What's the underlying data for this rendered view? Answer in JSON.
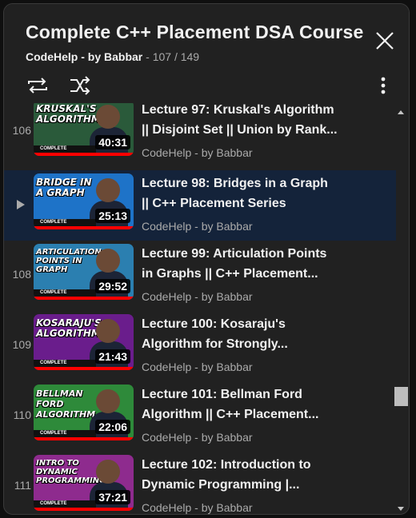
{
  "playlist": {
    "title": "Complete C++ Placement DSA Course",
    "channel": "CodeHelp - by Babbar",
    "position": "- 107 / 149"
  },
  "icons": {
    "close": "close-icon",
    "loop": "loop-icon",
    "shuffle": "shuffle-icon",
    "more": "more-vert-icon"
  },
  "colors": {
    "panel": "#212121",
    "active_row": "#14233a",
    "progress": "#ff0000"
  },
  "videos": [
    {
      "index": "106",
      "title_line1": "Lecture 97: Kruskal's Algorithm",
      "title_line2": "|| Disjoint Set || Union by Rank...",
      "channel": "CodeHelp - by Babbar",
      "thumb_text": "KRUSKAL'S ALGORITHM",
      "thumb_badge": "COMPLETE",
      "duration": "40:31",
      "thumb_color": "#2a5a3a"
    },
    {
      "index": "",
      "title_line1": "Lecture 98: Bridges in a Graph",
      "title_line2": "|| C++ Placement Series",
      "channel": "CodeHelp - by Babbar",
      "thumb_text": "BRIDGE IN A GRAPH",
      "thumb_badge": "COMPLETE",
      "duration": "25:13",
      "thumb_color": "#1e73c8"
    },
    {
      "index": "108",
      "title_line1": "Lecture 99: Articulation Points",
      "title_line2": "in Graphs || C++ Placement...",
      "channel": "CodeHelp - by Babbar",
      "thumb_text": "ARTICULATION POINTS IN GRAPH",
      "thumb_badge": "COMPLETE",
      "duration": "29:52",
      "thumb_color": "#2b7fb0"
    },
    {
      "index": "109",
      "title_line1": "Lecture 100: Kosaraju's",
      "title_line2": "Algorithm for Strongly...",
      "channel": "CodeHelp - by Babbar",
      "thumb_text": "KOSARAJU'S ALGORITHM",
      "thumb_badge": "COMPLETE",
      "duration": "21:43",
      "thumb_color": "#6a1d8c"
    },
    {
      "index": "110",
      "title_line1": "Lecture 101: Bellman Ford",
      "title_line2": "Algorithm || C++ Placement...",
      "channel": "CodeHelp - by Babbar",
      "thumb_text": "BELLMAN FORD ALGORITHM",
      "thumb_badge": "COMPLETE",
      "duration": "22:06",
      "thumb_color": "#2e8a3a"
    },
    {
      "index": "111",
      "title_line1": "Lecture 102: Introduction to",
      "title_line2": "Dynamic Programming |...",
      "channel": "CodeHelp - by Babbar",
      "thumb_text": "INTRO TO DYNAMIC PROGRAMMING",
      "thumb_badge": "COMPLETE",
      "duration": "37:21",
      "thumb_color": "#8e2b8e"
    }
  ]
}
